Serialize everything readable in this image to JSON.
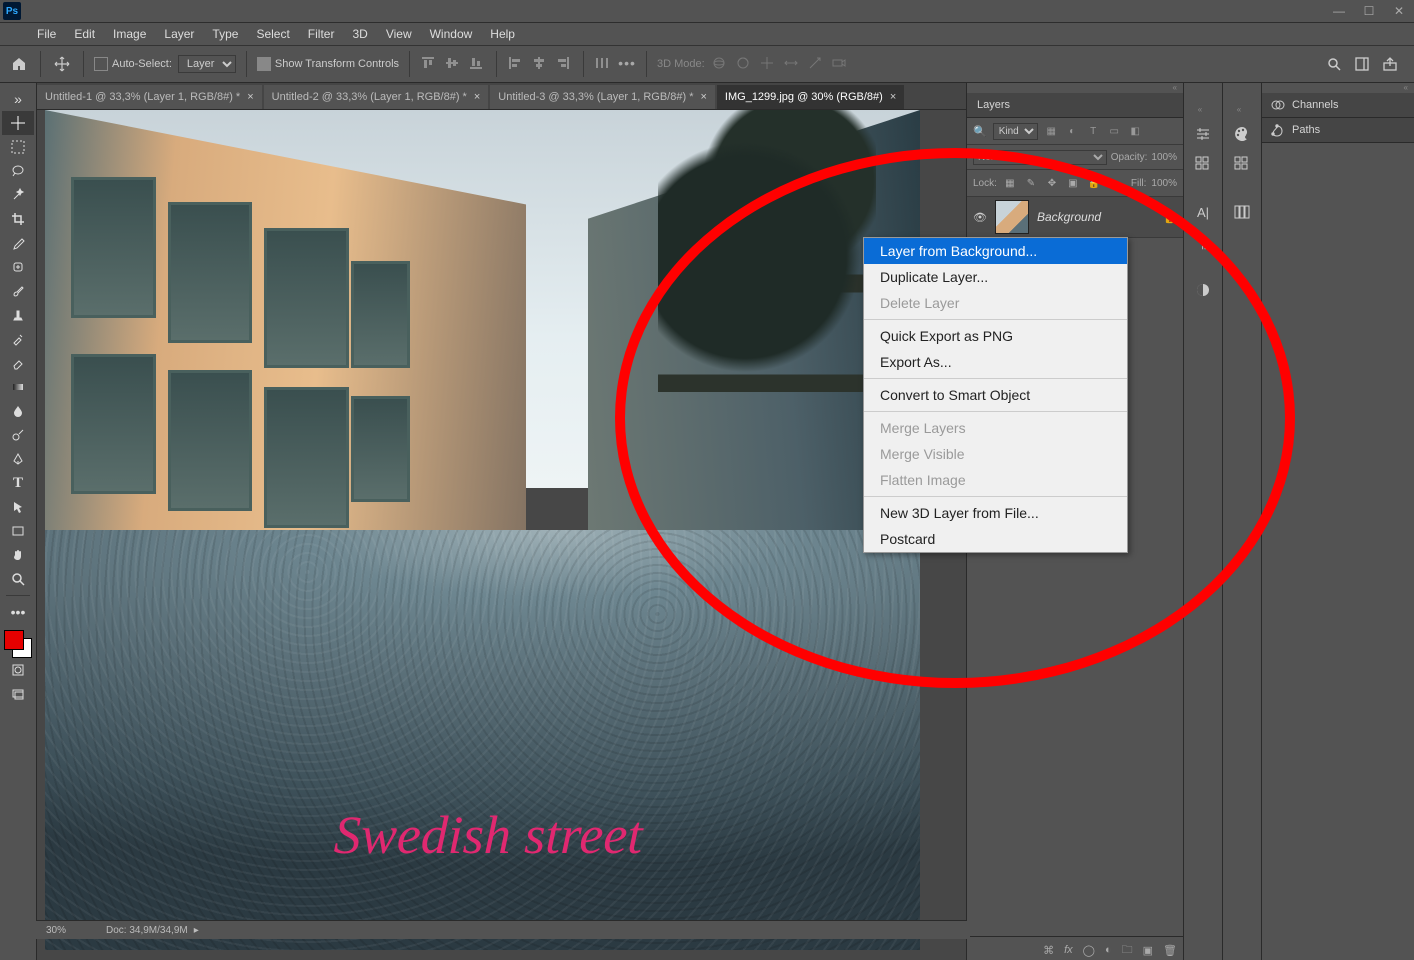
{
  "app": {
    "logo": "Ps"
  },
  "window_buttons": {
    "min": "—",
    "max": "☐",
    "close": "✕"
  },
  "menu": [
    "File",
    "Edit",
    "Image",
    "Layer",
    "Type",
    "Select",
    "Filter",
    "3D",
    "View",
    "Window",
    "Help"
  ],
  "options_bar": {
    "auto_select_label": "Auto-Select:",
    "auto_select_mode": "Layer",
    "show_transform": "Show Transform Controls",
    "threeD_mode": "3D Mode:"
  },
  "doc_tabs": [
    {
      "label": "Untitled-1 @ 33,3% (Layer 1, RGB/8#) *",
      "active": false
    },
    {
      "label": "Untitled-2 @ 33,3% (Layer 1, RGB/8#) *",
      "active": false
    },
    {
      "label": "Untitled-3 @ 33,3% (Layer 1, RGB/8#) *",
      "active": false
    },
    {
      "label": "IMG_1299.jpg @ 30% (RGB/8#)",
      "active": true
    }
  ],
  "canvas_text": "Swedish street",
  "status": {
    "zoom": "30%",
    "doc_size": "Doc: 34,9M/34,9M"
  },
  "layers_panel": {
    "tab": "Layers",
    "kind_filter": "Kind",
    "search_icon": "🔍",
    "blend_mode": "Normal",
    "opacity_label": "Opacity:",
    "opacity_value": "100%",
    "fill_label": "Fill:",
    "fill_value": "100%",
    "lock_label": "Lock:",
    "layer_name": "Background"
  },
  "right_tabs": {
    "channels": "Channels",
    "paths": "Paths",
    "character": "A|",
    "paragraph": "¶"
  },
  "context_menu": {
    "items": [
      {
        "label": "Layer from Background...",
        "state": "highlight"
      },
      {
        "label": "Duplicate Layer...",
        "state": "normal"
      },
      {
        "label": "Delete Layer",
        "state": "disabled"
      },
      {
        "sep": true
      },
      {
        "label": "Quick Export as PNG",
        "state": "normal"
      },
      {
        "label": "Export As...",
        "state": "normal"
      },
      {
        "sep": true
      },
      {
        "label": "Convert to Smart Object",
        "state": "normal"
      },
      {
        "sep": true
      },
      {
        "label": "Merge Layers",
        "state": "disabled"
      },
      {
        "label": "Merge Visible",
        "state": "disabled"
      },
      {
        "label": "Flatten Image",
        "state": "disabled"
      },
      {
        "sep": true
      },
      {
        "label": "New 3D Layer from File...",
        "state": "normal"
      },
      {
        "label": "Postcard",
        "state": "normal"
      }
    ]
  }
}
